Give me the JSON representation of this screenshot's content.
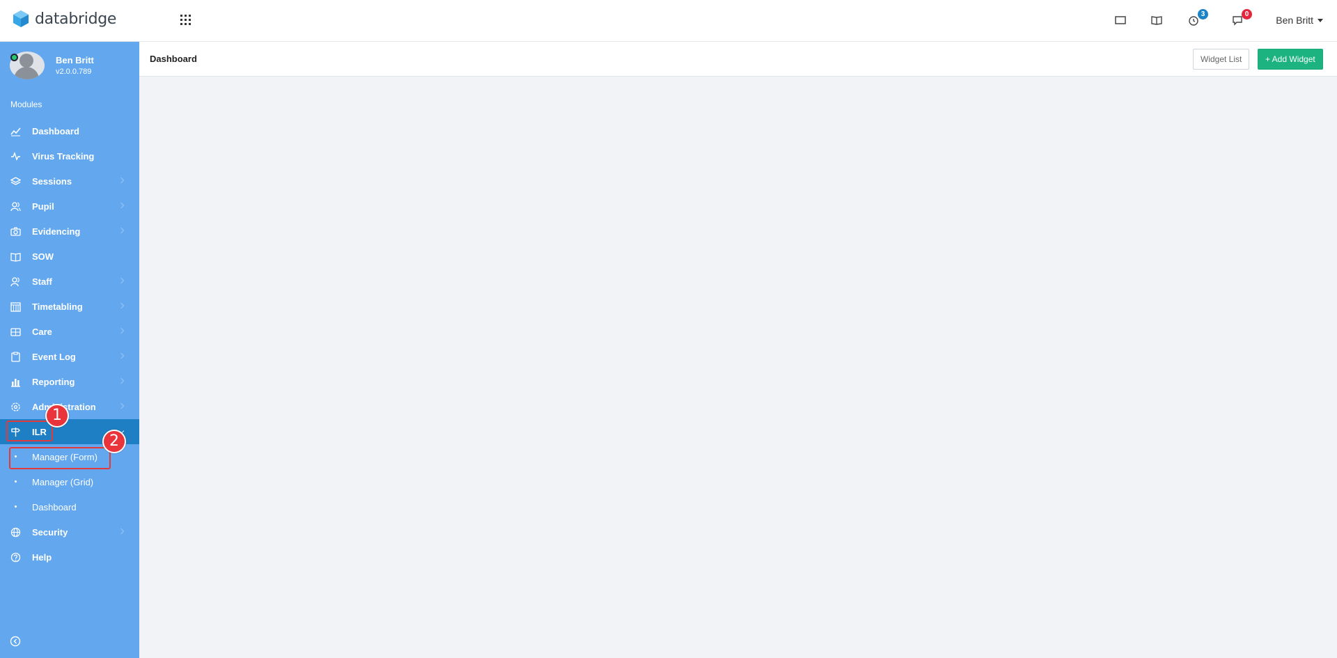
{
  "brand": {
    "name": "databridge",
    "color": "#36a6e8"
  },
  "header": {
    "user_name": "Ben Britt",
    "icons": [
      {
        "name": "window-icon",
        "badge": null
      },
      {
        "name": "book-icon",
        "badge": null
      },
      {
        "name": "clock-icon",
        "badge": "3"
      },
      {
        "name": "chat-icon",
        "badge": "0"
      }
    ]
  },
  "sidebar": {
    "profile": {
      "name": "Ben Britt",
      "version": "v2.0.0.789"
    },
    "section_label": "Modules",
    "items": [
      {
        "label": "Dashboard",
        "icon": "chart-line-icon",
        "expandable": false
      },
      {
        "label": "Virus Tracking",
        "icon": "pulse-icon",
        "expandable": false
      },
      {
        "label": "Sessions",
        "icon": "layers-icon",
        "expandable": true
      },
      {
        "label": "Pupil",
        "icon": "users-icon",
        "expandable": true
      },
      {
        "label": "Evidencing",
        "icon": "camera-icon",
        "expandable": true
      },
      {
        "label": "SOW",
        "icon": "book-icon",
        "expandable": false
      },
      {
        "label": "Staff",
        "icon": "users-icon",
        "expandable": true
      },
      {
        "label": "Timetabling",
        "icon": "calendar-icon",
        "expandable": true
      },
      {
        "label": "Care",
        "icon": "medical-icon",
        "expandable": true
      },
      {
        "label": "Event Log",
        "icon": "clipboard-icon",
        "expandable": true
      },
      {
        "label": "Reporting",
        "icon": "bar-chart-icon",
        "expandable": true
      },
      {
        "label": "Administration",
        "icon": "gear-icon",
        "expandable": true
      },
      {
        "label": "ILR",
        "icon": "signpost-icon",
        "expandable": true,
        "active": true
      },
      {
        "label": "Manager (Form)",
        "sub": true
      },
      {
        "label": "Manager (Grid)",
        "sub": true
      },
      {
        "label": "Dashboard",
        "sub": true
      },
      {
        "label": "Security",
        "icon": "globe-icon",
        "expandable": true
      },
      {
        "label": "Help",
        "icon": "help-icon",
        "expandable": false
      }
    ]
  },
  "annotations": [
    {
      "number": "1",
      "target": "ILR"
    },
    {
      "number": "2",
      "target": "Manager (Form)"
    }
  ],
  "content": {
    "title": "Dashboard",
    "widget_list_label": "Widget List",
    "add_widget_label": "+ Add Widget"
  },
  "colors": {
    "sidebar": "#63a8ef",
    "active_item": "#1f7fc4",
    "add_button": "#1cb381",
    "annotation": "#e8343a"
  }
}
